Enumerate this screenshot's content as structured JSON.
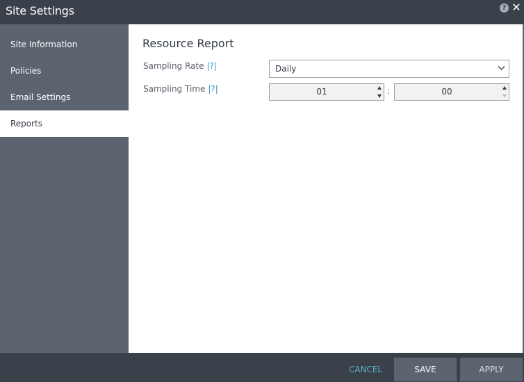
{
  "window": {
    "title": "Site Settings",
    "help_glyph": "?",
    "close_glyph": "✕"
  },
  "sidebar": {
    "items": [
      {
        "label": "Site Information",
        "active": false
      },
      {
        "label": "Policies",
        "active": false
      },
      {
        "label": "Email Settings",
        "active": false
      },
      {
        "label": "Reports",
        "active": true
      }
    ]
  },
  "main": {
    "section_title": "Resource Report",
    "sampling_rate": {
      "label": "Sampling Rate",
      "help": "|?|",
      "value": "Daily"
    },
    "sampling_time": {
      "label": "Sampling Time",
      "help": "|?|",
      "hours": "01",
      "separator": ":",
      "minutes": "00"
    }
  },
  "footer": {
    "cancel_label": "CANCEL",
    "save_label": "SAVE",
    "apply_label": "APPLY"
  },
  "colors": {
    "titlebar": "#3b414b",
    "sidebar": "#5c6470",
    "accent_link": "#3a8fc9",
    "cancel_text": "#5ab2c4"
  },
  "icons": [
    "help-icon",
    "close-icon",
    "chevron-down-icon",
    "spin-up-icon",
    "spin-down-icon"
  ]
}
